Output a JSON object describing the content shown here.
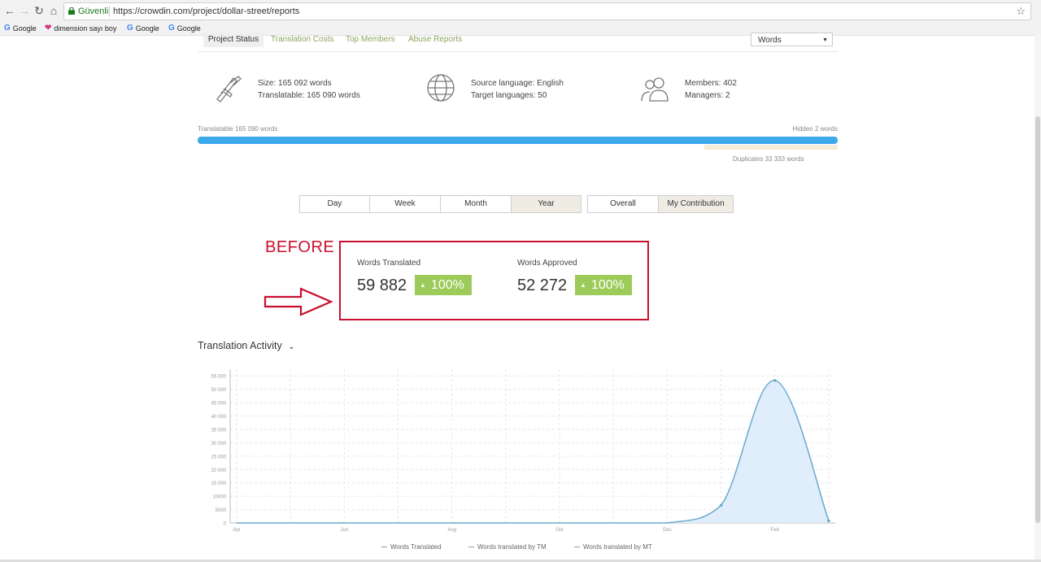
{
  "browser": {
    "secure_label": "Güvenli",
    "url": "https://crowdin.com/project/dollar-street/reports",
    "bookmarks": [
      {
        "icon": "google-icon",
        "label": "Google"
      },
      {
        "icon": "dimension-icon",
        "label": "dimension sayı boyutu"
      },
      {
        "icon": "google-icon",
        "label": "Google"
      },
      {
        "icon": "google-icon",
        "label": "Google"
      }
    ]
  },
  "tabs": {
    "items": [
      "Project Status",
      "Translation Costs",
      "Top Members",
      "Abuse Reports"
    ],
    "active": "Project Status",
    "units_select": "Words"
  },
  "stats": {
    "size": "Size: 165 092 words",
    "translatable": "Translatable: 165 090 words",
    "source_language": "Source language: English",
    "target_languages": "Target languages: 50",
    "members": "Members: 402",
    "managers": "Managers: 2"
  },
  "progress": {
    "left_label": "Translatable 165 090 words",
    "right_label": "Hidden 2 words",
    "duplicates_label": "Duplicates 33 333 words",
    "translatable_fraction": 0.9999
  },
  "periods": [
    "Day",
    "Week",
    "Month",
    "Year"
  ],
  "period_active": "Year",
  "scopes": [
    "Overall",
    "My Contribution"
  ],
  "scope_active": "My Contribution",
  "annotation": {
    "label": "BEFORE"
  },
  "metrics": {
    "words_translated_label": "Words Translated",
    "words_translated_value": "59 882",
    "words_translated_change": "100%",
    "words_approved_label": "Words Approved",
    "words_approved_value": "52 272",
    "words_approved_change": "100%"
  },
  "chart_title": "Translation Activity",
  "colors": {
    "accent_green": "#9ccb5a",
    "link_green": "#8aa35b",
    "progress_blue": "#3ba9ea",
    "annotation_red": "#c8102e",
    "chart_line": "#6aa9cf",
    "chart_fill": "#dbecf9"
  },
  "chart_data": {
    "type": "area",
    "title": "Translation Activity",
    "x_ticks": [
      "Apr",
      "Jun",
      "Aug",
      "Oct",
      "Dec",
      "Feb"
    ],
    "y_ticks": [
      "0",
      "5000",
      "10000",
      "15 000",
      "20 000",
      "25 000",
      "30 000",
      "35 000",
      "40 000",
      "45 000",
      "50 000",
      "55 000"
    ],
    "ylim": [
      0,
      57500
    ],
    "series": [
      {
        "name": "Words Translated",
        "points": [
          {
            "month": "Apr",
            "value": 0
          },
          {
            "month": "May",
            "value": 0
          },
          {
            "month": "Jun",
            "value": 0
          },
          {
            "month": "Jul",
            "value": 0
          },
          {
            "month": "Aug",
            "value": 0
          },
          {
            "month": "Sep",
            "value": 0
          },
          {
            "month": "Oct",
            "value": 0
          },
          {
            "month": "Nov",
            "value": 0
          },
          {
            "month": "Dec",
            "value": 0
          },
          {
            "month": "Jan",
            "value": 6600
          },
          {
            "month": "Feb",
            "value": 53300
          },
          {
            "month": "Mar",
            "value": 800
          }
        ]
      },
      {
        "name": "Words translated by TM",
        "points": []
      },
      {
        "name": "Words translated by MT",
        "points": []
      }
    ],
    "grid": true,
    "legend": "bottom"
  }
}
